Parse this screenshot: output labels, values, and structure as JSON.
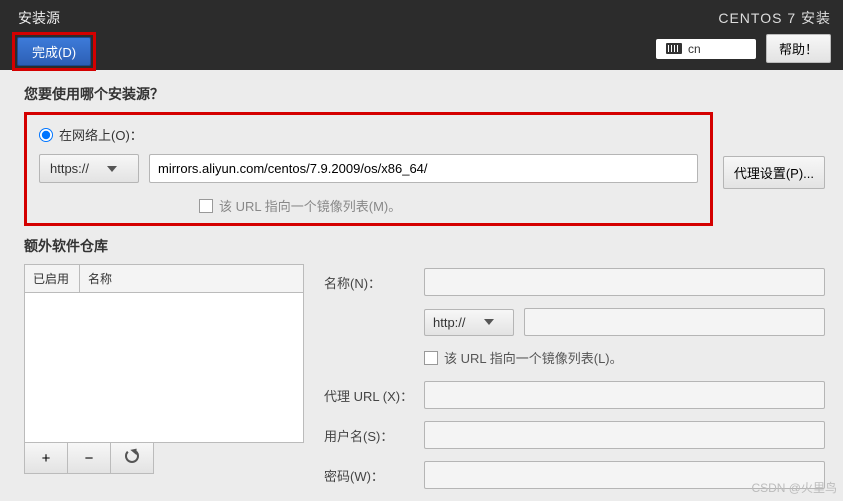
{
  "header": {
    "title": "安装源",
    "done_label": "完成(D)",
    "right_title": "CENTOS 7 安装",
    "lang": "cn",
    "help_label": "帮助！"
  },
  "source": {
    "question": "您要使用哪个安装源？",
    "radio_label": "在网络上(O)：",
    "protocol": "https://",
    "url_value": "mirrors.aliyun.com/centos/7.9.2009/os/x86_64/",
    "proxy_label": "代理设置(P)...",
    "mirrorlist_label": "该 URL 指向一个镜像列表(M)。"
  },
  "repos": {
    "title": "额外软件仓库",
    "col_enabled": "已启用",
    "col_name": "名称",
    "add": "+",
    "remove": "−"
  },
  "form": {
    "name_label": "名称(N)：",
    "protocol": "http://",
    "mirrorlist_label": "该 URL 指向一个镜像列表(L)。",
    "proxy_url_label": "代理 URL (X)：",
    "user_label": "用户名(S)：",
    "pass_label": "密码(W)："
  },
  "watermark": "CSDN @火里鸟"
}
